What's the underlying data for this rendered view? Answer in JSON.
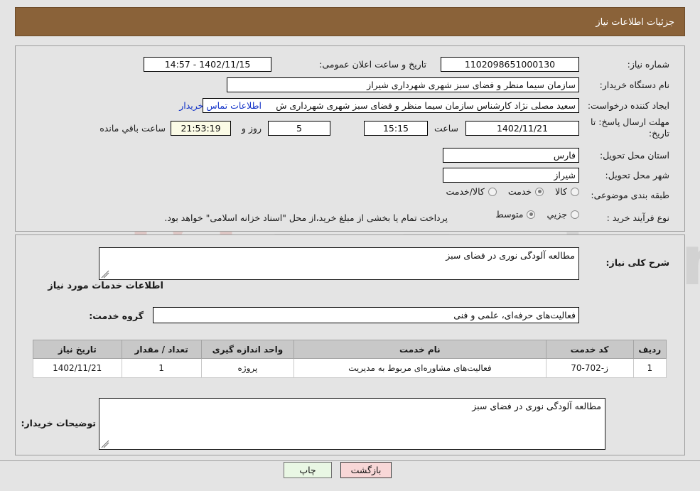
{
  "header": {
    "title": "جزئیات اطلاعات نیاز"
  },
  "top_form": {
    "need_number": {
      "label": "شماره نیاز:",
      "value": "1102098651000130"
    },
    "announce_datetime": {
      "label": "تاریخ و ساعت اعلان عمومی:",
      "value": "1402/11/15 - 14:57"
    },
    "buyer_org": {
      "label": "نام دستگاه خریدار:",
      "value": "سازمان سیما منظر و فضای سبز شهری شهرداری شیراز"
    },
    "requester": {
      "label": "ایجاد کننده درخواست:",
      "value": "سعید مصلی نژاد کارشناس سازمان سیما منظر و فضای سبز شهری شهرداری ش",
      "contact_link": "اطلاعات تماس خریدار"
    },
    "reply_deadline": {
      "label_line1": "مهلت ارسال پاسخ: تا",
      "label_line2": "تاریخ:",
      "date": "1402/11/21",
      "hour_label": "ساعت",
      "hour": "15:15",
      "days": "5",
      "days_suffix": "روز و",
      "countdown": "21:53:19",
      "countdown_suffix": "ساعت باقي مانده"
    },
    "delivery_province": {
      "label": "استان محل تحویل:",
      "value": "فارس"
    },
    "delivery_city": {
      "label": "شهر محل تحویل:",
      "value": "شیراز"
    },
    "subject_class": {
      "label": "طبقه بندی موضوعی:",
      "options": [
        "کالا",
        "خدمت",
        "کالا/خدمت"
      ],
      "selected": "خدمت"
    },
    "purchase_type": {
      "label": "نوع فرآیند خرید :",
      "options": [
        "جزیي",
        "متوسط"
      ],
      "selected": "متوسط",
      "note": "پرداخت تمام یا بخشی از مبلغ خرید،از محل \"اسناد خزانه اسلامی\" خواهد بود."
    }
  },
  "bottom_form": {
    "general_desc": {
      "label": "شرح کلی نیاز:",
      "value": "مطالعه آلودگی نوری در فضای سبز"
    },
    "services_section_title": "اطلاعات خدمات مورد نیاز",
    "service_group": {
      "label": "گروه خدمت:",
      "value": "فعالیت‌های حرفه‌ای، علمی و فنی"
    },
    "table": {
      "columns": [
        "ردیف",
        "کد خدمت",
        "نام خدمت",
        "واحد اندازه گیری",
        "تعداد / مقدار",
        "تاریخ نیاز"
      ],
      "rows": [
        {
          "row": "1",
          "service_code": "ز-702-70",
          "service_name": "فعالیت‌های مشاوره‌ای مربوط به مدیریت",
          "unit": "پروژه",
          "quantity": "1",
          "need_date": "1402/11/21"
        }
      ]
    },
    "buyer_notes": {
      "label": "توضیحات خریدار:",
      "value": "مطالعه آلودگی نوری در فضای سبز"
    }
  },
  "footer": {
    "back_button": "بازگشت",
    "print_button": "چاپ"
  },
  "watermark": {
    "text": "AnaTender.net"
  }
}
